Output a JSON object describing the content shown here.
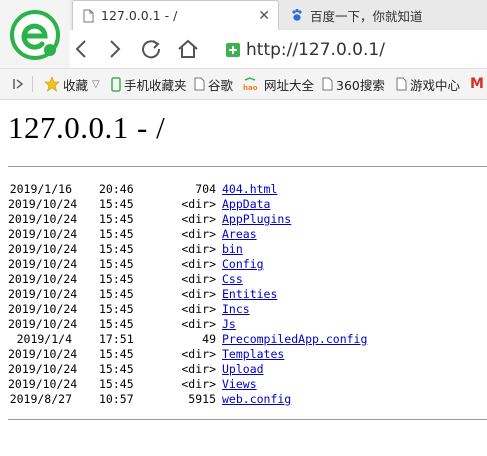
{
  "browser": {
    "tabs": [
      {
        "title": "127.0.0.1 - /",
        "icon": "page-icon",
        "active": true
      },
      {
        "title": "百度一下，你就知道",
        "icon": "baidu-paw-icon",
        "active": false
      }
    ],
    "address": {
      "scheme": "http://",
      "host": "127.0.0.1",
      "path": "/"
    },
    "bookmarks": [
      {
        "label": "收藏",
        "icon": "star-icon"
      },
      {
        "label": "手机收藏夹",
        "icon": "phone-icon"
      },
      {
        "label": "谷歌",
        "icon": "page-icon"
      },
      {
        "label": "网址大全",
        "icon": "hao-icon"
      },
      {
        "label": "360搜索",
        "icon": "page-icon"
      },
      {
        "label": "游戏中心",
        "icon": "page-icon"
      },
      {
        "label": "M",
        "icon": "gmail-icon"
      }
    ],
    "colors": {
      "accent": "#3fb14e",
      "logo_green": "#2bb34a",
      "link": "#0000cc"
    }
  },
  "page": {
    "title": "127.0.0.1 - /",
    "entries": [
      {
        "date": "2019/1/16",
        "time": "20:46",
        "size": "704",
        "name": "404.html"
      },
      {
        "date": "2019/10/24",
        "time": "15:45",
        "size": "<dir>",
        "name": "AppData"
      },
      {
        "date": "2019/10/24",
        "time": "15:45",
        "size": "<dir>",
        "name": "AppPlugins"
      },
      {
        "date": "2019/10/24",
        "time": "15:45",
        "size": "<dir>",
        "name": "Areas"
      },
      {
        "date": "2019/10/24",
        "time": "15:45",
        "size": "<dir>",
        "name": "bin"
      },
      {
        "date": "2019/10/24",
        "time": "15:45",
        "size": "<dir>",
        "name": "Config"
      },
      {
        "date": "2019/10/24",
        "time": "15:45",
        "size": "<dir>",
        "name": "Css"
      },
      {
        "date": "2019/10/24",
        "time": "15:45",
        "size": "<dir>",
        "name": "Entities"
      },
      {
        "date": "2019/10/24",
        "time": "15:45",
        "size": "<dir>",
        "name": "Incs"
      },
      {
        "date": "2019/10/24",
        "time": "15:45",
        "size": "<dir>",
        "name": "Js"
      },
      {
        "date": "2019/1/4",
        "time": "17:51",
        "size": "49",
        "name": "PrecompiledApp.config"
      },
      {
        "date": "2019/10/24",
        "time": "15:45",
        "size": "<dir>",
        "name": "Templates"
      },
      {
        "date": "2019/10/24",
        "time": "15:45",
        "size": "<dir>",
        "name": "Upload"
      },
      {
        "date": "2019/10/24",
        "time": "15:45",
        "size": "<dir>",
        "name": "Views"
      },
      {
        "date": "2019/8/27",
        "time": "10:57",
        "size": "5915",
        "name": "web.config"
      }
    ]
  }
}
